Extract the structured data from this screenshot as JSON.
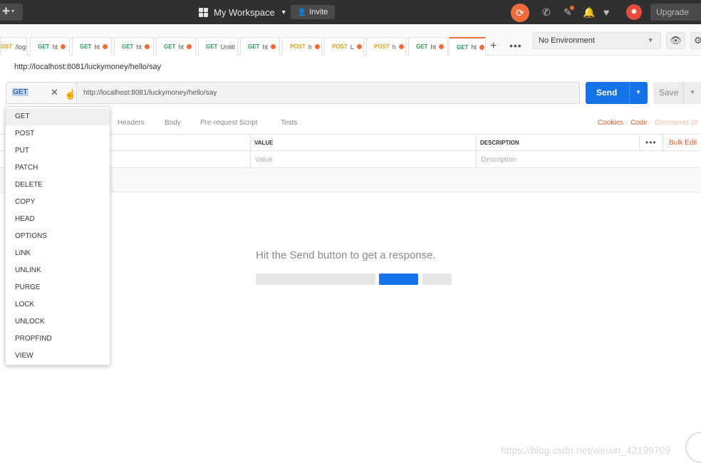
{
  "topbar": {
    "workspace_label": "My Workspace",
    "invite_label": "Invite",
    "upgrade_label": "Upgrade"
  },
  "tabs": [
    {
      "method": "OST",
      "title": "/logi",
      "method_color": "post",
      "dot": false,
      "active": false
    },
    {
      "method": "GET",
      "title": "ht",
      "method_color": "get",
      "dot": true,
      "active": false
    },
    {
      "method": "GET",
      "title": "ht",
      "method_color": "get",
      "dot": true,
      "active": false
    },
    {
      "method": "GET",
      "title": "ht",
      "method_color": "get",
      "dot": true,
      "active": false
    },
    {
      "method": "GET",
      "title": "ht",
      "method_color": "get",
      "dot": true,
      "active": false
    },
    {
      "method": "GET",
      "title": "Untitl",
      "method_color": "get",
      "dot": false,
      "active": false
    },
    {
      "method": "GET",
      "title": "ht",
      "method_color": "get",
      "dot": true,
      "active": false
    },
    {
      "method": "POST",
      "title": "h",
      "method_color": "post",
      "dot": true,
      "active": false
    },
    {
      "method": "POST",
      "title": "L",
      "method_color": "post",
      "dot": true,
      "active": false
    },
    {
      "method": "POST",
      "title": "h",
      "method_color": "post",
      "dot": true,
      "active": false
    },
    {
      "method": "GET",
      "title": "ht",
      "method_color": "get",
      "dot": true,
      "active": false
    },
    {
      "method": "GET",
      "title": "ht",
      "method_color": "get",
      "dot": true,
      "active": true
    }
  ],
  "environment": {
    "selected": "No Environment"
  },
  "request": {
    "name": "http://localhost:8081/luckymoney/hello/say",
    "method": "GET",
    "url": "http://localhost:8081/luckymoney/hello/say",
    "send_label": "Send",
    "save_label": "Save"
  },
  "subtabs": [
    "Headers",
    "Body",
    "Pre-request Script",
    "Tests"
  ],
  "right_links": {
    "cookies": "Cookies",
    "code": "Code",
    "comments": "Comments (0"
  },
  "params_table": {
    "value_header": "VALUE",
    "description_header": "DESCRIPTION",
    "bulk_edit": "Bulk Edit",
    "value_placeholder": "Value",
    "description_placeholder": "Description"
  },
  "response": {
    "hint": "Hit the Send button to get a response."
  },
  "method_menu": {
    "items": [
      "GET",
      "POST",
      "PUT",
      "PATCH",
      "DELETE",
      "COPY",
      "HEAD",
      "OPTIONS",
      "LINK",
      "UNLINK",
      "PURGE",
      "LOCK",
      "UNLOCK",
      "PROPFIND",
      "VIEW"
    ],
    "selected": "GET"
  },
  "watermark": "https://blog.csdn.net/weixin_42199709",
  "colors": {
    "accent_orange": "#f26b3a",
    "send_blue": "#1473e6",
    "get_green": "#2a9d5e",
    "post_yellow": "#e8a020"
  },
  "icons": {
    "new": "plus-icon",
    "workspace": "grid-icon",
    "invite": "add-user-icon",
    "sync": "sync-icon",
    "satellite": "satellite-icon",
    "settings": "wrench-icon",
    "notifications": "bell-icon",
    "favorites": "heart-icon",
    "eye": "eye-icon",
    "gear": "gear-icon",
    "clear": "close-icon"
  }
}
